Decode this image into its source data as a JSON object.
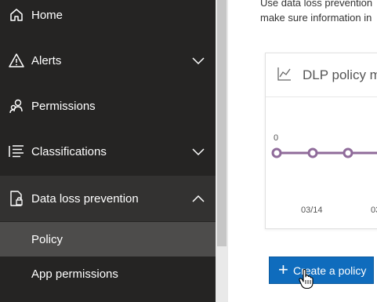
{
  "sidebar": {
    "items": [
      {
        "label": "Home",
        "icon": "home-icon"
      },
      {
        "label": "Alerts",
        "icon": "warning-icon"
      },
      {
        "label": "Permissions",
        "icon": "people-icon"
      },
      {
        "label": "Classifications",
        "icon": "list-icon"
      },
      {
        "label": "Data loss prevention",
        "icon": "document-lock-icon"
      }
    ],
    "subitems": [
      {
        "label": "Policy",
        "selected": true
      },
      {
        "label": "App permissions"
      }
    ]
  },
  "main": {
    "description_line1": "Use data loss prevention",
    "description_line2": "make sure information in",
    "card": {
      "title": "DLP policy m"
    },
    "create_button_label": "Create a policy"
  },
  "chart_data": {
    "type": "line",
    "series": [
      {
        "values": [
          0,
          0,
          0,
          0
        ]
      }
    ],
    "data_labels": [
      "0"
    ],
    "x_tick_labels": [
      "03/14",
      "03"
    ],
    "line_color": "#8f6b9a",
    "grid": false
  },
  "colors": {
    "sidebar_bg": "#252423",
    "selected_bg": "#4d4c4b",
    "accent": "#0f6cbd",
    "series": "#8f6b9a"
  }
}
